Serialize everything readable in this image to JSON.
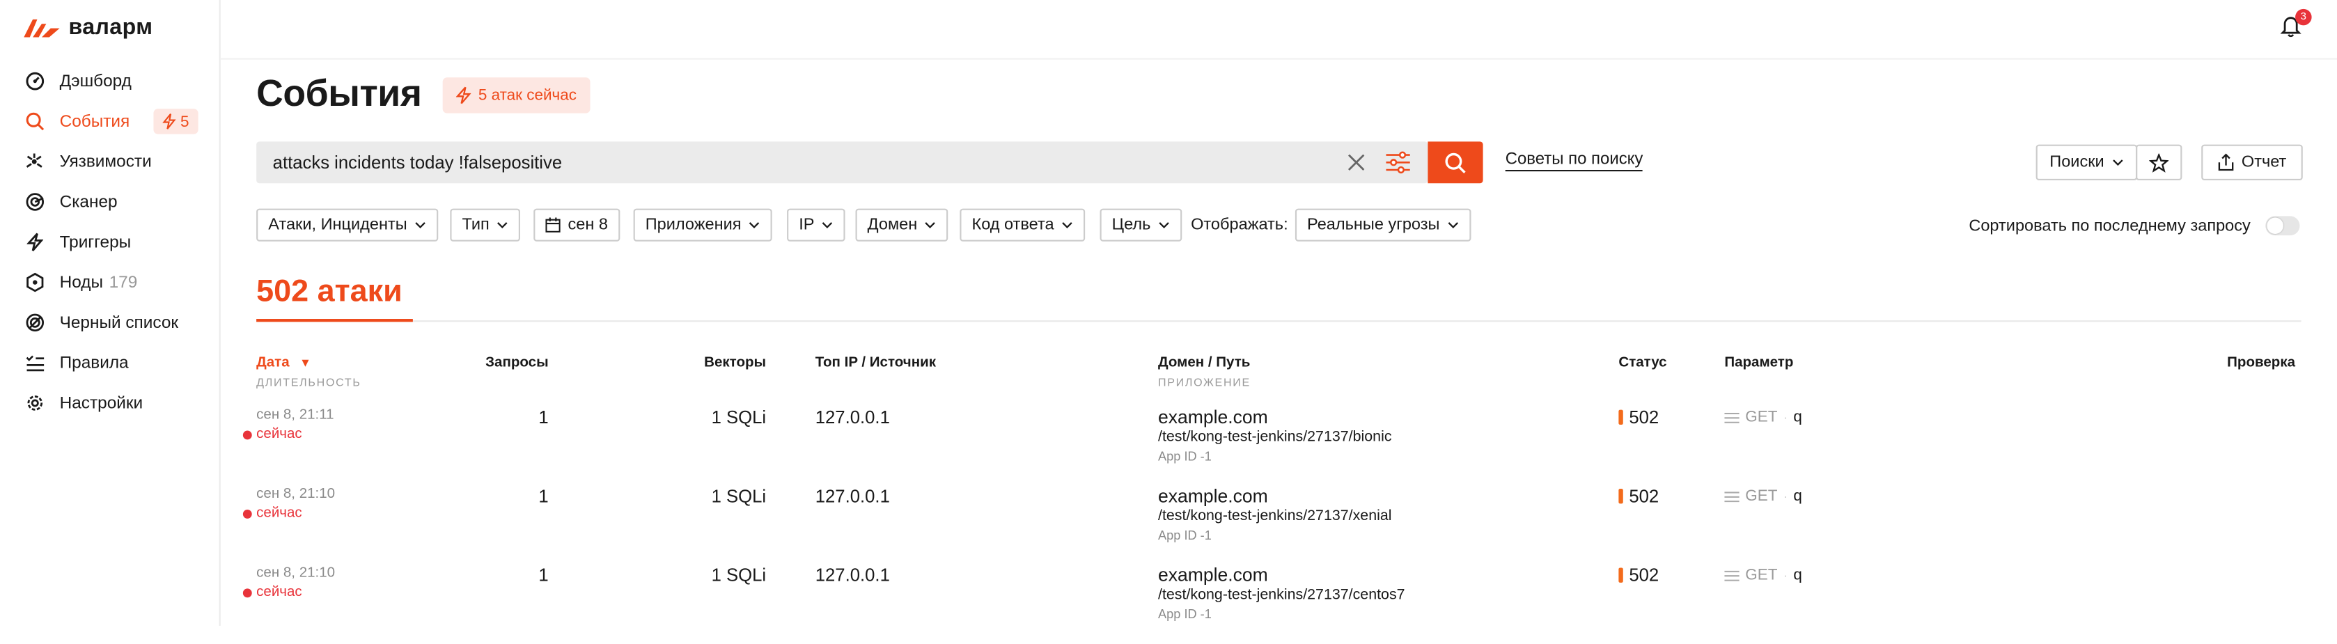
{
  "app": {
    "logo_text": "валарм",
    "notifications_count": "3"
  },
  "sidebar": {
    "items": [
      {
        "label": "Дэшборд",
        "icon": "dashboard-icon"
      },
      {
        "label": "События",
        "icon": "search-icon",
        "active": true,
        "badge": "5"
      },
      {
        "label": "Уязвимости",
        "icon": "vulnerability-icon"
      },
      {
        "label": "Сканер",
        "icon": "scanner-icon"
      },
      {
        "label": "Триггеры",
        "icon": "lightning-icon"
      },
      {
        "label": "Ноды",
        "icon": "nodes-icon",
        "count": "179"
      },
      {
        "label": "Черный список",
        "icon": "blacklist-icon"
      },
      {
        "label": "Правила",
        "icon": "rules-icon"
      },
      {
        "label": "Настройки",
        "icon": "settings-icon"
      }
    ]
  },
  "header": {
    "title": "События",
    "attacks_now": "5 атак сейчас"
  },
  "search": {
    "query": "attacks incidents today !falsepositive",
    "tips_link": "Советы по поиску",
    "searches_label": "Поиски",
    "report_label": "Отчет"
  },
  "filters": {
    "chips": [
      "Атаки, Инциденты",
      "Тип",
      "сен 8",
      "Приложения",
      "IP",
      "Домен",
      "Код ответа",
      "Цель"
    ],
    "show_label": "Отображать:",
    "show_value": "Реальные угрозы",
    "sort_label": "Сортировать по последнему запросу"
  },
  "results": {
    "count_heading": "502 атаки",
    "columns": {
      "date": "Дата",
      "date_sub": "ДЛИТЕЛЬНОСТЬ",
      "requests": "Запросы",
      "vectors": "Векторы",
      "top_ip": "Топ IP / Источник",
      "domain": "Домен / Путь",
      "domain_sub": "ПРИЛОЖЕНИЕ",
      "status": "Статус",
      "param": "Параметр",
      "check": "Проверка"
    },
    "rows": [
      {
        "date": "сен 8, 21:11",
        "duration": "сейчас",
        "requests": "1",
        "vectors": "1 SQLi",
        "ip": "127.0.0.1",
        "domain": "example.com",
        "path": "/test/kong-test-jenkins/27137/bionic",
        "app": "App ID -1",
        "status": "502",
        "method": "GET",
        "param": "q"
      },
      {
        "date": "сен 8, 21:10",
        "duration": "сейчас",
        "requests": "1",
        "vectors": "1 SQLi",
        "ip": "127.0.0.1",
        "domain": "example.com",
        "path": "/test/kong-test-jenkins/27137/xenial",
        "app": "App ID -1",
        "status": "502",
        "method": "GET",
        "param": "q"
      },
      {
        "date": "сен 8, 21:10",
        "duration": "сейчас",
        "requests": "1",
        "vectors": "1 SQLi",
        "ip": "127.0.0.1",
        "domain": "example.com",
        "path": "/test/kong-test-jenkins/27137/centos7",
        "app": "App ID -1",
        "status": "502",
        "method": "GET",
        "param": "q"
      }
    ]
  },
  "colors": {
    "accent": "#ee4a1b",
    "danger": "#e8333a",
    "status": "#f36b1c"
  }
}
